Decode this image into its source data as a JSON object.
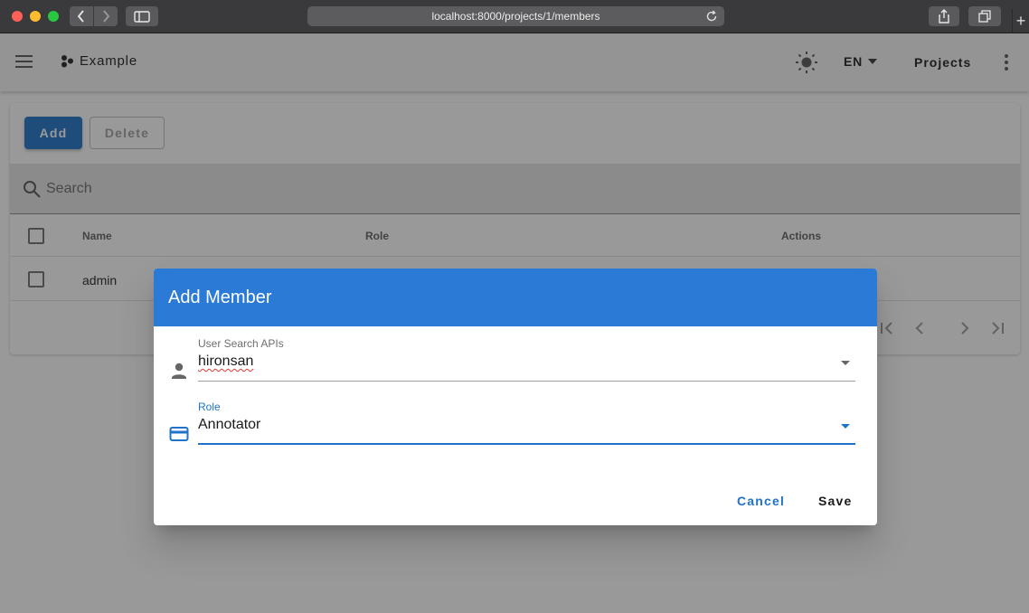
{
  "browser": {
    "url": "localhost:8000/projects/1/members"
  },
  "appbar": {
    "brand": "Example",
    "language": "EN",
    "projects_label": "Projects"
  },
  "toolbar": {
    "add_label": "Add",
    "delete_label": "Delete"
  },
  "search": {
    "placeholder": "Search"
  },
  "table": {
    "columns": [
      "Name",
      "Role",
      "Actions"
    ],
    "rows": [
      {
        "name": "admin"
      }
    ]
  },
  "dialog": {
    "title": "Add Member",
    "user_field": {
      "label": "User Search APIs",
      "value": "hironsan"
    },
    "role_field": {
      "label": "Role",
      "value": "Annotator"
    },
    "cancel_label": "Cancel",
    "save_label": "Save"
  },
  "colors": {
    "primary": "#1f73c8",
    "dialog_header": "#2a7ad6",
    "appbar_bg": "#f5f5f5"
  }
}
